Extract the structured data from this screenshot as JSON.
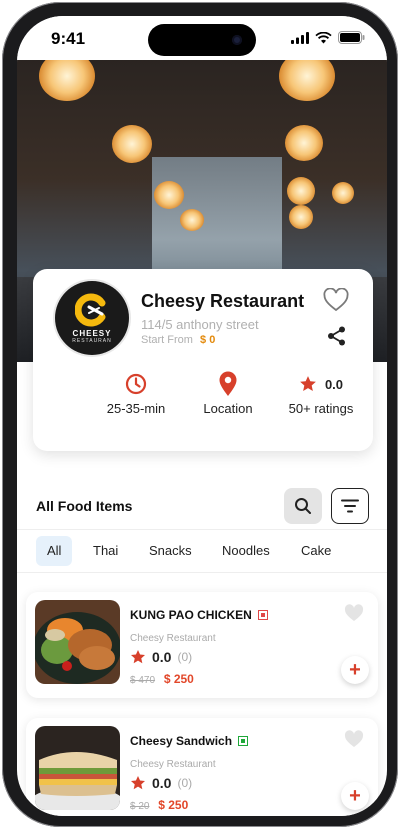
{
  "status_bar": {
    "time": "9:41"
  },
  "restaurant": {
    "name": "Cheesy Restaurant",
    "address": "114/5 anthony street",
    "start_from_label": "Start From",
    "start_from_price": "$ 0",
    "logo_name": "CHEESY",
    "logo_sub": "RESTAURAN",
    "stats": {
      "delivery_time": "25-35-min",
      "location": "Location",
      "rating": "0.0",
      "ratings_count": "50+ ratings"
    }
  },
  "section": {
    "title": "All Food Items"
  },
  "tabs": [
    {
      "label": "All",
      "active": true
    },
    {
      "label": "Thai"
    },
    {
      "label": "Snacks"
    },
    {
      "label": "Noodles"
    },
    {
      "label": "Cake"
    }
  ],
  "foods": [
    {
      "name": "KUNG PAO CHICKEN",
      "diet": "non-veg",
      "restaurant": "Cheesy Restaurant",
      "rating": "0.0",
      "rating_count": "(0)",
      "old_price": "$ 470",
      "price": "$ 250",
      "add_label": "+"
    },
    {
      "name": "Cheesy Sandwich",
      "diet": "veg",
      "restaurant": "Cheesy Restaurant",
      "rating": "0.0",
      "rating_count": "(0)",
      "old_price": "$ 20",
      "price": "$ 250",
      "add_label": "+"
    }
  ],
  "colors": {
    "accent_orange": "#e38a0c",
    "accent_red": "#d7402b",
    "tab_active_bg": "#e6f1fb",
    "non_veg": "#e04848",
    "veg": "#1fa83a"
  }
}
